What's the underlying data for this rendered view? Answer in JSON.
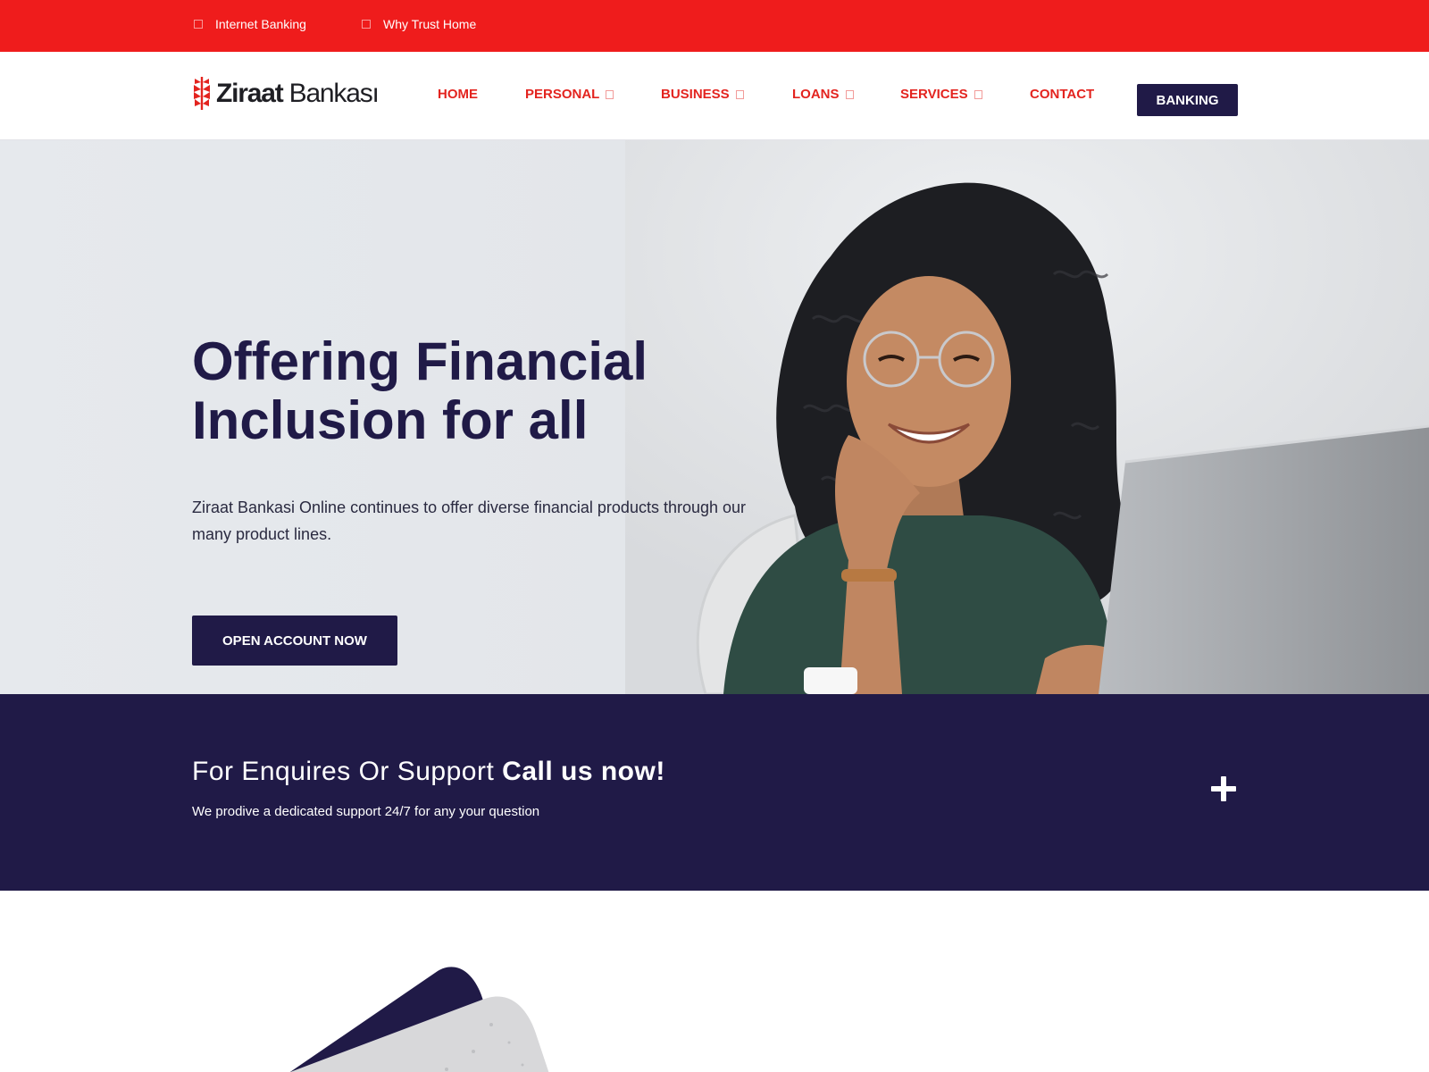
{
  "topbar": {
    "links": [
      {
        "label": "Internet Banking",
        "icon": "desktop-icon"
      },
      {
        "label": "Why Trust Home",
        "icon": "shield-icon"
      }
    ]
  },
  "header": {
    "logo": {
      "name_bold": "Ziraat",
      "name_rest": " Bankası",
      "icon": "wheat-logo-icon"
    },
    "nav": [
      {
        "label": "HOME",
        "dropdown": false
      },
      {
        "label": "PERSONAL",
        "dropdown": true
      },
      {
        "label": "BUSINESS",
        "dropdown": true
      },
      {
        "label": "LOANS",
        "dropdown": true
      },
      {
        "label": "SERVICES",
        "dropdown": true
      },
      {
        "label": "CONTACT",
        "dropdown": false
      }
    ],
    "banking_button": "BANKING"
  },
  "hero": {
    "title_line1": "Offering Financial",
    "title_line2": "Inclusion for all",
    "subtitle": "Ziraat Bankasi Online continues to offer diverse financial products through our many product lines.",
    "cta": "OPEN ACCOUNT NOW"
  },
  "support": {
    "title_regular": "For Enquires Or Support ",
    "title_bold": "Call us now!",
    "subtitle": "We prodive a dedicated support 24/7 for any your question",
    "icon": "plus-icon"
  },
  "colors": {
    "brand_red": "#ef1c1c",
    "nav_red": "#e3241f",
    "navy": "#201a47",
    "hero_bg": "#e3e6ea"
  }
}
